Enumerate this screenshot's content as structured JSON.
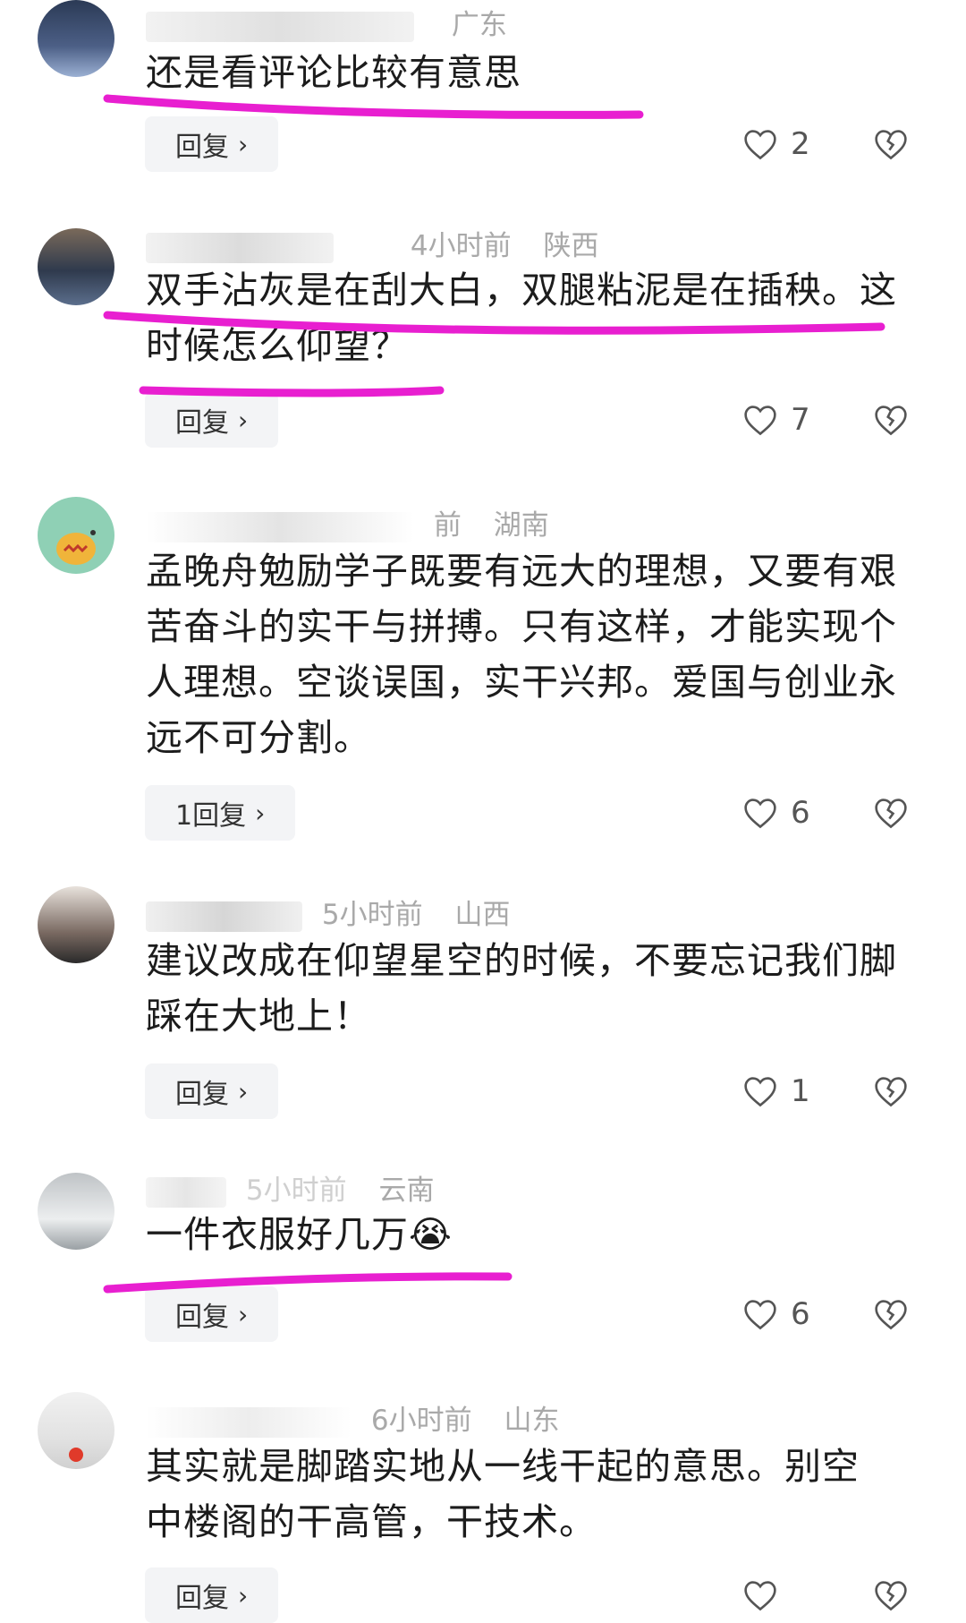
{
  "comments": [
    {
      "region": "广东",
      "time": "",
      "text": "还是看评论比较有意思",
      "reply_label": "回复",
      "likes": "2"
    },
    {
      "region": "陕西",
      "time": "4小时前",
      "text": "双手沾灰是在刮大白，双腿粘泥是在插秧。这时候怎么仰望？",
      "reply_label": "回复",
      "likes": "7"
    },
    {
      "region": "湖南",
      "time": "前",
      "text": "孟晚舟勉励学子既要有远大的理想，又要有艰苦奋斗的实干与拼搏。只有这样，才能实现个人理想。空谈误国，实干兴邦。爱国与创业永远不可分割。",
      "reply_label": "1回复",
      "likes": "6"
    },
    {
      "region": "山西",
      "time": "5小时前",
      "text": "建议改成在仰望星空的时候，不要忘记我们脚踩在大地上！",
      "reply_label": "回复",
      "likes": "1"
    },
    {
      "region": "云南",
      "time": "5小时前",
      "text": "一件衣服好几万",
      "reply_label": "回复",
      "likes": "6",
      "emoji": "😭"
    },
    {
      "region": "山东",
      "time": "6小时前",
      "text": "其实就是脚踏实地从一线干起的意思。别空中楼阁的干高管，干技术。",
      "reply_label": "回复",
      "likes": ""
    }
  ],
  "colors": {
    "highlight": "#e81fd0",
    "meta": "#a9a9a9",
    "reply_bg": "#f3f4f6"
  },
  "icons": {
    "like": "heart-outline-icon",
    "dislike": "broken-heart-icon",
    "reply": "chevron-right-icon"
  }
}
